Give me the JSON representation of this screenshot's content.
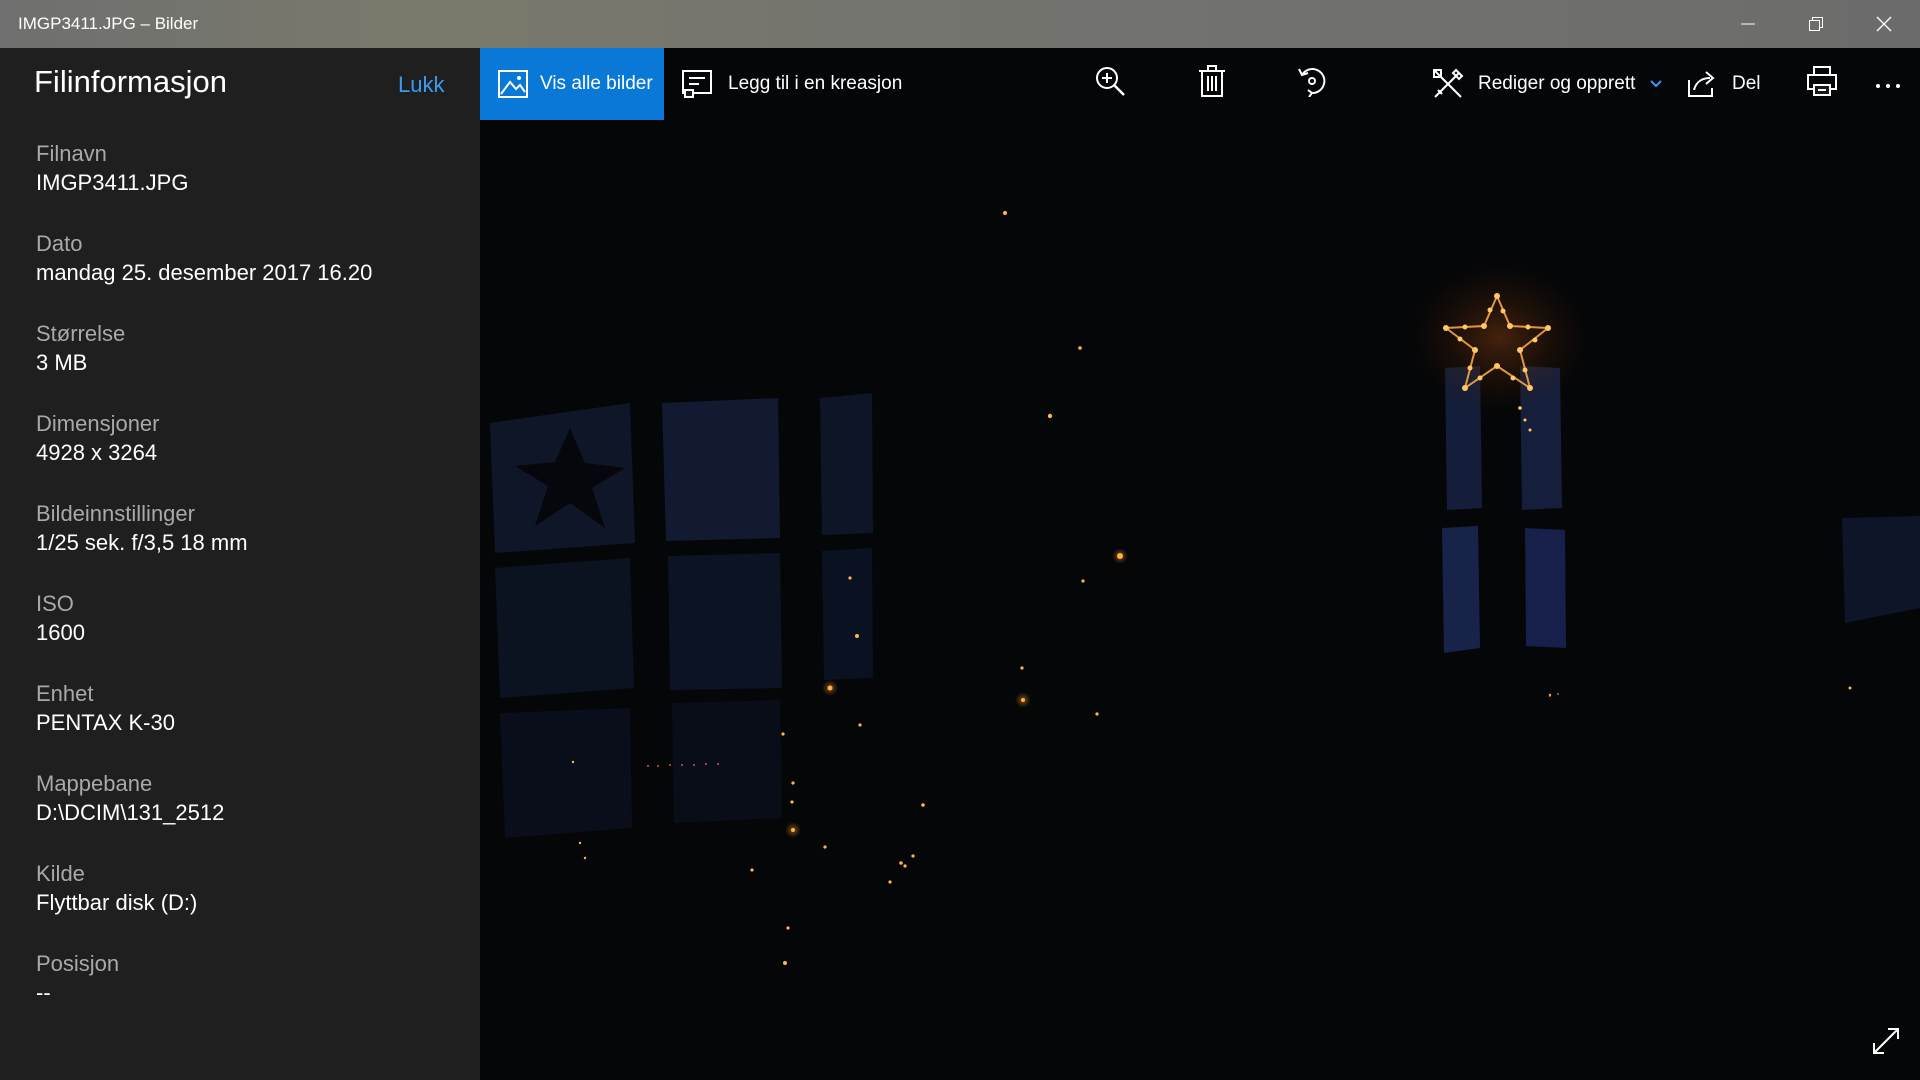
{
  "window": {
    "title": "IMGP3411.JPG – Bilder"
  },
  "panel": {
    "title": "Filinformasjon",
    "close_label": "Lukk",
    "fields": [
      {
        "label": "Filnavn",
        "value": "IMGP3411.JPG"
      },
      {
        "label": "Dato",
        "value": "mandag 25. desember 2017 16.20"
      },
      {
        "label": "Størrelse",
        "value": "3 MB"
      },
      {
        "label": "Dimensjoner",
        "value": "4928 x 3264"
      },
      {
        "label": "Bildeinnstillinger",
        "value": "1/25 sek. f/3,5 18 mm"
      },
      {
        "label": "ISO",
        "value": "1600"
      },
      {
        "label": "Enhet",
        "value": "PENTAX K-30"
      },
      {
        "label": "Mappebane",
        "value": "D:\\DCIM\\131_2512"
      },
      {
        "label": "Kilde",
        "value": "Flyttbar disk (D:)"
      },
      {
        "label": "Posisjon",
        "value": "--"
      }
    ]
  },
  "toolbar": {
    "show_all_label": "Vis alle bilder",
    "add_creation_label": "Legg til i en kreasjon",
    "edit_label": "Rediger og opprett",
    "share_label": "Del",
    "icons": [
      "zoom-in-icon",
      "delete-icon",
      "rotate-icon",
      "print-icon",
      "more-icon",
      "expand-icon"
    ]
  },
  "colors": {
    "accent": "#0a78d7",
    "link": "#3a9bf4",
    "panel_bg": "#1f1f1f"
  }
}
